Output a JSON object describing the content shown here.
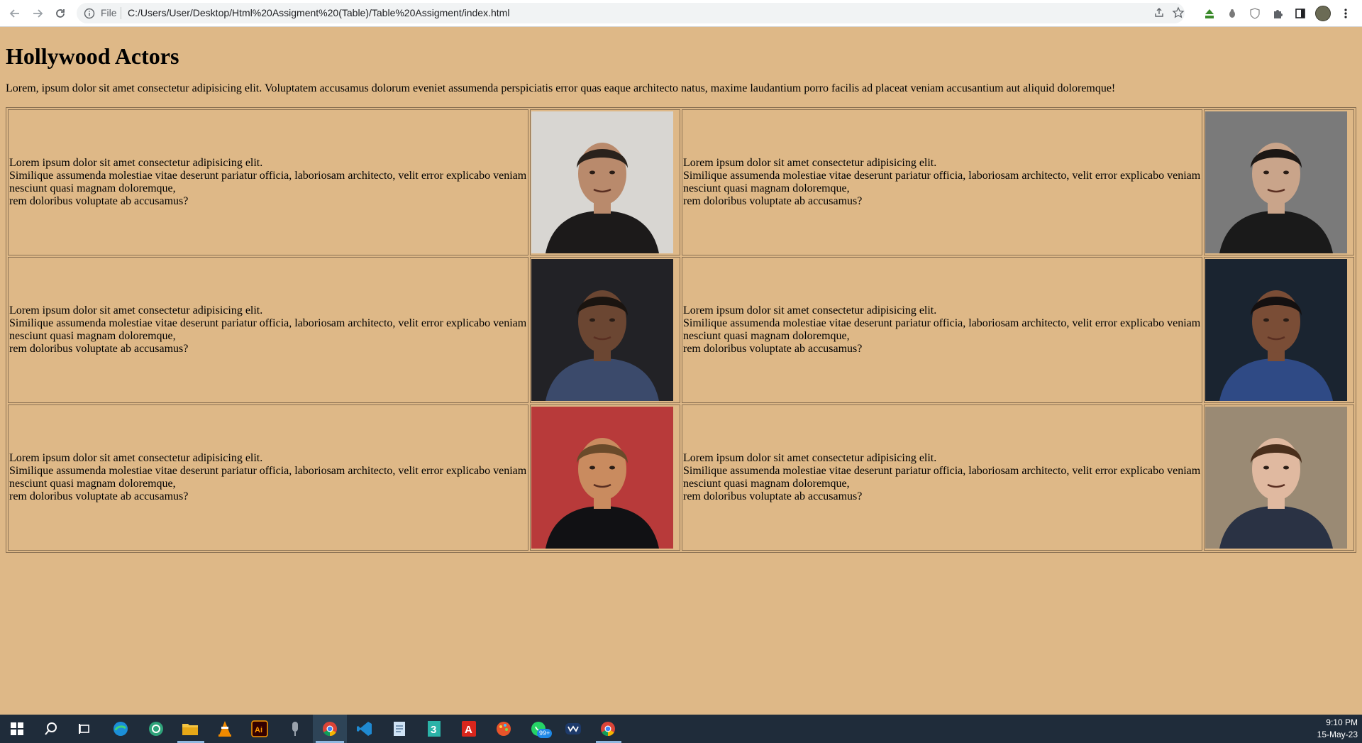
{
  "browser": {
    "file_label": "File",
    "url": "C:/Users/User/Desktop/Html%20Assigment%20(Table)/Table%20Assigment/index.html"
  },
  "page": {
    "title": "Hollywood Actors",
    "intro": "Lorem, ipsum dolor sit amet consectetur adipisicing elit. Voluptatem accusamus dolorum eveniet assumenda perspiciatis error quas eaque architecto natus, maxime laudantium porro facilis ad placeat veniam accusantium aut aliquid doloremque!"
  },
  "cell_text": {
    "line1": "Lorem ipsum dolor sit amet consectetur adipisicing elit.",
    "line2": "Similique assumenda molestiae vitae deserunt pariatur officia, laboriosam architecto, velit error explicabo veniam nesciunt quasi magnam doloremque,",
    "line3": "rem doloribus voluptate ab accusamus?"
  },
  "actors": [
    {
      "photo": "actor-photo-1",
      "bg": "#d8d6d2",
      "skin": "#b98a6c",
      "hair": "#2a221c",
      "suit": "#1c1a1a"
    },
    {
      "photo": "actor-photo-2",
      "bg": "#7a7a7a",
      "skin": "#c9a48a",
      "hair": "#1c1714",
      "suit": "#1a1a1a"
    },
    {
      "photo": "actor-photo-3",
      "bg": "#222226",
      "skin": "#6b4632",
      "hair": "#1a1410",
      "suit": "#3b4a6b"
    },
    {
      "photo": "actor-photo-4",
      "bg": "#1a2430",
      "skin": "#7a4d36",
      "hair": "#141010",
      "suit": "#2f4a85"
    },
    {
      "photo": "actor-photo-5",
      "bg": "#b83a3a",
      "skin": "#c98b5f",
      "hair": "#6a4a2a",
      "suit": "#111114"
    },
    {
      "photo": "actor-photo-6",
      "bg": "#9a8a74",
      "skin": "#e0b9a0",
      "hair": "#4a2f1c",
      "suit": "#2a3244"
    }
  ],
  "taskbar": {
    "time": "9:10 PM",
    "date": "15-May-23",
    "whatsapp_badge": "99+"
  },
  "colors": {
    "page_bg": "#deb887",
    "taskbar_bg": "#1f2c3a"
  }
}
